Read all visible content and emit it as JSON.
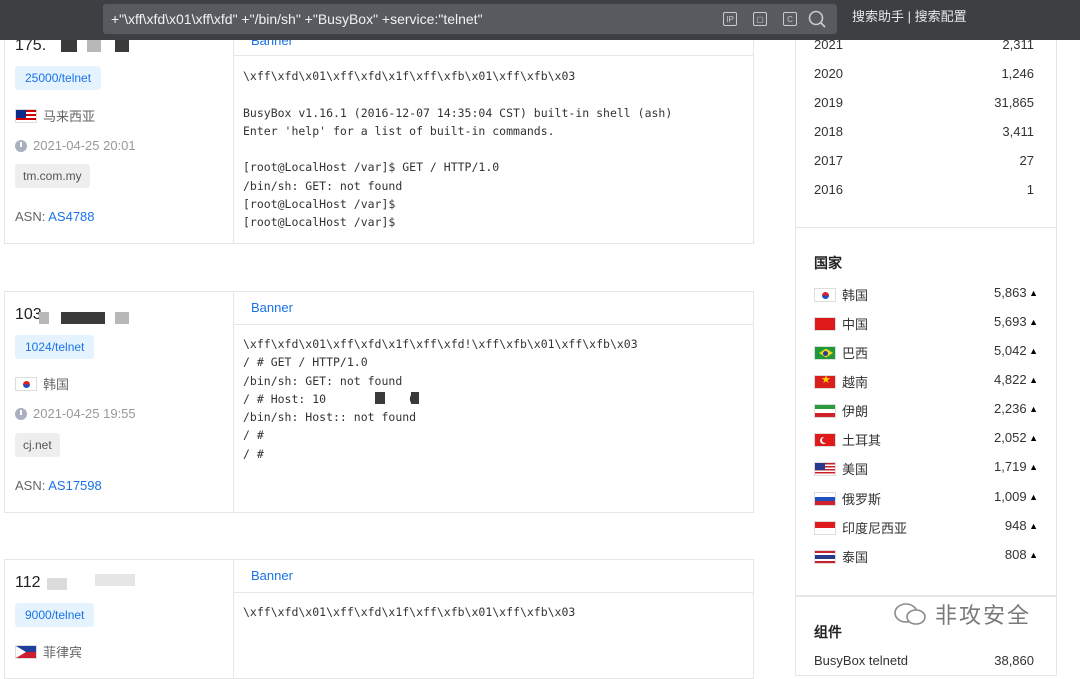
{
  "search": {
    "query": "+\"\\xff\\xfd\\x01\\xff\\xfd\" +\"/bin/sh\" +\"BusyBox\" +service:\"telnet\"",
    "icons": [
      "ip-icon",
      "image-search-icon",
      "c-icon",
      "search-icon"
    ],
    "helper_label": "搜索助手 | 搜索配置"
  },
  "results": [
    {
      "ip": "175.",
      "service": "25000/telnet",
      "country": "马来西亚",
      "time": "2021-04-25 20:01",
      "domain": "tm.com.my",
      "asn_label": "ASN:",
      "asn": "AS4788",
      "banner_tab": "Banner",
      "banner": "\\xff\\xfd\\x01\\xff\\xfd\\x1f\\xff\\xfb\\x01\\xff\\xfb\\x03\n\nBusyBox v1.16.1 (2016-12-07 14:35:04 CST) built-in shell (ash)\nEnter 'help' for a list of built-in commands.\n\n[root@LocalHost /var]$ GET / HTTP/1.0\n/bin/sh: GET: not found\n[root@LocalHost /var]$\n[root@LocalHost /var]$"
    },
    {
      "ip": "103",
      "service": "1024/telnet",
      "country": "韩国",
      "time": "2021-04-25 19:55",
      "domain": "cj.net",
      "asn_label": "ASN:",
      "asn": "AS17598",
      "banner_tab": "Banner",
      "banner": "\\xff\\xfd\\x01\\xff\\xfd\\x1f\\xff\\xfd!\\xff\\xfb\\x01\\xff\\xfb\\x03\n/ # GET / HTTP/1.0\n/bin/sh: GET: not found\n/ # Host: 10            6\n/bin/sh: Host:: not found\n/ #\n/ #"
    },
    {
      "ip": "112",
      "service": "9000/telnet",
      "country": "菲律宾",
      "banner_tab": "Banner",
      "banner": "\\xff\\xfd\\x01\\xff\\xfd\\x1f\\xff\\xfb\\x01\\xff\\xfb\\x03"
    }
  ],
  "years": [
    {
      "year": "2021",
      "count": "2,311"
    },
    {
      "year": "2020",
      "count": "1,246"
    },
    {
      "year": "2019",
      "count": "31,865"
    },
    {
      "year": "2018",
      "count": "3,411"
    },
    {
      "year": "2017",
      "count": "27"
    },
    {
      "year": "2016",
      "count": "1"
    }
  ],
  "countries_title": "国家",
  "countries": [
    {
      "name": "韩国",
      "count": "5,863",
      "flag": "f-kr"
    },
    {
      "name": "中国",
      "count": "5,693",
      "flag": "f-cn"
    },
    {
      "name": "巴西",
      "count": "5,042",
      "flag": "f-br"
    },
    {
      "name": "越南",
      "count": "4,822",
      "flag": "f-vn"
    },
    {
      "name": "伊朗",
      "count": "2,236",
      "flag": "f-ir"
    },
    {
      "name": "土耳其",
      "count": "2,052",
      "flag": "f-tr"
    },
    {
      "name": "美国",
      "count": "1,719",
      "flag": "f-us"
    },
    {
      "name": "俄罗斯",
      "count": "1,009",
      "flag": "f-ru"
    },
    {
      "name": "印度尼西亚",
      "count": "948",
      "flag": "f-id"
    },
    {
      "name": "泰国",
      "count": "808",
      "flag": "f-th"
    }
  ],
  "components_title": "组件",
  "components": [
    {
      "name": "BusyBox telnetd",
      "count": "38,860"
    }
  ],
  "watermark": "非攻安全"
}
